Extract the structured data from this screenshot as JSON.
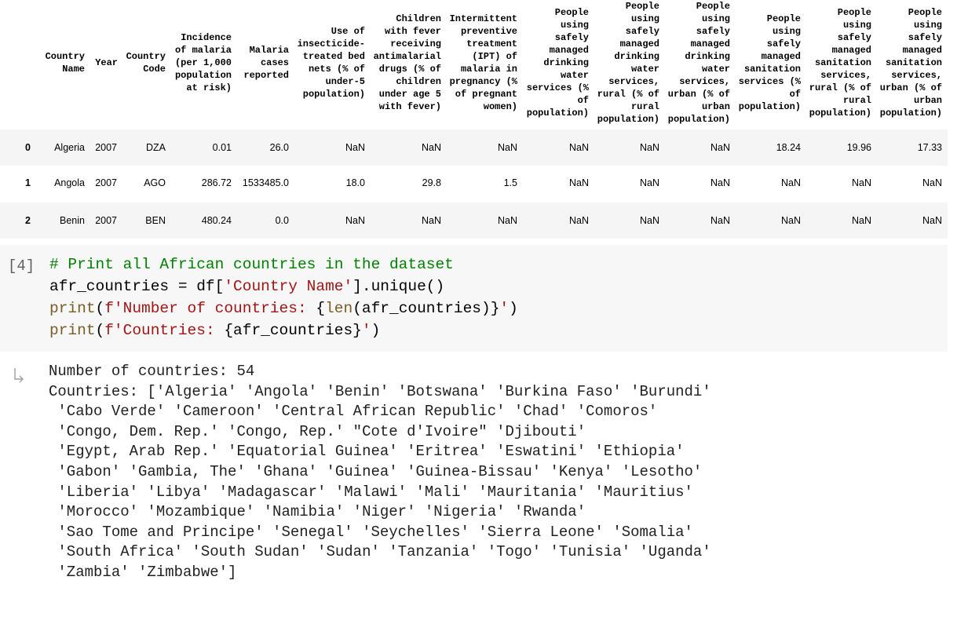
{
  "dataframe": {
    "columns": [
      "",
      "Country\nName",
      "Year",
      "Country\nCode",
      "Incidence\nof malaria\n(per 1,000\npopulation\nat risk)",
      "Malaria\ncases\nreported",
      "Use of\ninsecticide-\ntreated bed\nnets (% of\nunder-5\npopulation)",
      "Children\nwith fever\nreceiving\nantimalarial\ndrugs (% of\nchildren\nunder age 5\nwith fever)",
      "Intermittent\npreventive\ntreatment\n(IPT) of\nmalaria in\npregnancy (%\nof pregnant\nwomen)",
      "People\nusing\nsafely\nmanaged\ndrinking\nwater\nservices (%\nof\npopulation)",
      "People\nusing\nsafely\nmanaged\ndrinking\nwater\nservices,\nrural (% of\nrural\npopulation)",
      "People\nusing\nsafely\nmanaged\ndrinking\nwater\nservices,\nurban (% of\nurban\npopulation)",
      "People\nusing\nsafely\nmanaged\nsanitation\nservices (%\nof\npopulation)",
      "People\nusing\nsafely\nmanaged\nsanitation\nservices,\nrural (% of\nrural\npopulation)",
      "People\nusing\nsafely\nmanaged\nsanitation\nservices,\nurban (% of\nurban\npopulation)"
    ],
    "rows": [
      [
        "0",
        "Algeria",
        "2007",
        "DZA",
        "0.01",
        "26.0",
        "NaN",
        "NaN",
        "NaN",
        "NaN",
        "NaN",
        "NaN",
        "18.24",
        "19.96",
        "17.33"
      ],
      [
        "1",
        "Angola",
        "2007",
        "AGO",
        "286.72",
        "1533485.0",
        "18.0",
        "29.8",
        "1.5",
        "NaN",
        "NaN",
        "NaN",
        "NaN",
        "NaN",
        "NaN"
      ],
      [
        "2",
        "Benin",
        "2007",
        "BEN",
        "480.24",
        "0.0",
        "NaN",
        "NaN",
        "NaN",
        "NaN",
        "NaN",
        "NaN",
        "NaN",
        "NaN",
        "NaN"
      ]
    ]
  },
  "code_cell": {
    "execution_count": "[4]",
    "line1": "# Print all African countries in the dataset",
    "line2_a": "afr_countries = df[",
    "line2_str": "'Country Name'",
    "line2_b": "].unique()",
    "line3_fn": "print",
    "line3_a": "(",
    "line3_str1": "f'Number of countries: ",
    "line3_mid1": "{",
    "line3_fn2": "len",
    "line3_mid2": "(afr_countries)}",
    "line3_str2": "'",
    "line3_end": ")",
    "line4_fn": "print",
    "line4_a": "(",
    "line4_str1": "f'Countries: ",
    "line4_mid": "{afr_countries}",
    "line4_str2": "'",
    "line4_end": ")"
  },
  "output": {
    "icon": "output-arrow-icon",
    "text": "Number of countries: 54\nCountries: ['Algeria' 'Angola' 'Benin' 'Botswana' 'Burkina Faso' 'Burundi'\n 'Cabo Verde' 'Cameroon' 'Central African Republic' 'Chad' 'Comoros'\n 'Congo, Dem. Rep.' 'Congo, Rep.' \"Cote d'Ivoire\" 'Djibouti'\n 'Egypt, Arab Rep.' 'Equatorial Guinea' 'Eritrea' 'Eswatini' 'Ethiopia'\n 'Gabon' 'Gambia, The' 'Ghana' 'Guinea' 'Guinea-Bissau' 'Kenya' 'Lesotho'\n 'Liberia' 'Libya' 'Madagascar' 'Malawi' 'Mali' 'Mauritania' 'Mauritius'\n 'Morocco' 'Mozambique' 'Namibia' 'Niger' 'Nigeria' 'Rwanda'\n 'Sao Tome and Principe' 'Senegal' 'Seychelles' 'Sierra Leone' 'Somalia'\n 'South Africa' 'South Sudan' 'Sudan' 'Tanzania' 'Togo' 'Tunisia' 'Uganda'\n 'Zambia' 'Zimbabwe']"
  },
  "colors": {
    "code_background": "#f7f7f7",
    "comment": "#008000",
    "string": "#a31515",
    "builtin": "#795e26",
    "row_stripe": "#f5f5f5"
  }
}
